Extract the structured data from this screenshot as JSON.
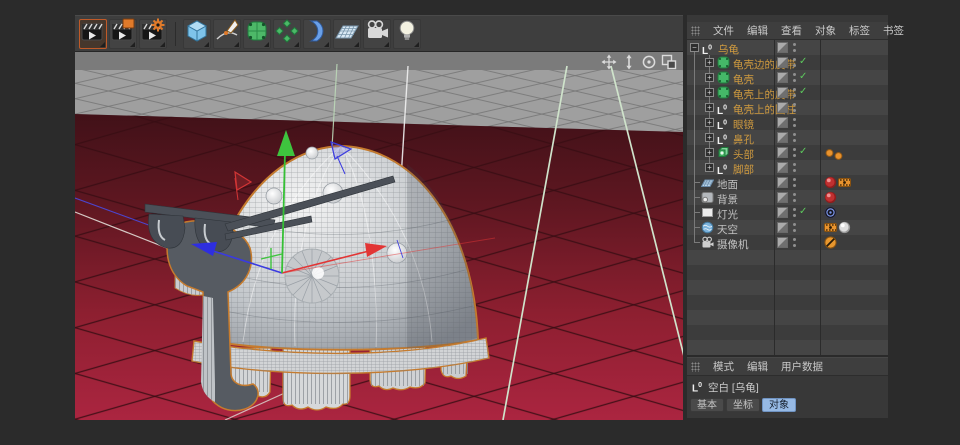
{
  "window": {
    "background": "#2b2b2b"
  },
  "toolbar": {
    "icons": [
      {
        "name": "render-view",
        "active": true
      },
      {
        "name": "render-to-picture-viewer",
        "active": false
      },
      {
        "name": "edit-render-settings",
        "active": false
      },
      {
        "name": "group-separator",
        "active": false
      },
      {
        "name": "add-cube",
        "active": false
      },
      {
        "name": "draw-spline",
        "active": false
      },
      {
        "name": "subdivision-surface",
        "active": false
      },
      {
        "name": "array-generator",
        "active": false
      },
      {
        "name": "bend-deformer",
        "active": false
      },
      {
        "name": "floor-environment",
        "active": false
      },
      {
        "name": "camera",
        "active": false
      },
      {
        "name": "light",
        "active": false
      }
    ]
  },
  "viewport": {
    "nav_icons": [
      "pan-icon",
      "zoom-icon",
      "rotate-icon",
      "toggle-view-icon"
    ],
    "colors": {
      "horizon_band": "#7b7b7b",
      "backdrop_plane": "#9f9f9f",
      "floor_near": "#ab2540",
      "floor_far": "#411118",
      "axis_x": "#e23535",
      "axis_y": "#3ec43e",
      "axis_z": "#3a3ae0",
      "selection_outline": "#c67b2d"
    }
  },
  "object_manager": {
    "menu": [
      "文件",
      "编辑",
      "查看",
      "对象",
      "标签",
      "书签"
    ],
    "tree": [
      {
        "label": "乌龟",
        "icon": "null",
        "depth": 0,
        "expand": "minus",
        "color": "orange",
        "check": false,
        "tags": []
      },
      {
        "label": "龟壳边的皮带",
        "icon": "subdiv",
        "depth": 1,
        "expand": "plus",
        "color": "orange",
        "check": true,
        "tags": []
      },
      {
        "label": "龟壳",
        "icon": "subdiv",
        "depth": 1,
        "expand": "plus",
        "color": "orange",
        "check": true,
        "tags": []
      },
      {
        "label": "龟壳上的皮带",
        "icon": "subdiv",
        "depth": 1,
        "expand": "plus",
        "color": "orange",
        "check": true,
        "tags": []
      },
      {
        "label": "龟壳上的圆柱",
        "icon": "null",
        "depth": 1,
        "expand": "plus",
        "color": "orange",
        "check": false,
        "tags": []
      },
      {
        "label": "眼镜",
        "icon": "null",
        "depth": 1,
        "expand": "plus",
        "color": "orange",
        "check": false,
        "tags": []
      },
      {
        "label": "鼻孔",
        "icon": "null",
        "depth": 1,
        "expand": "plus",
        "color": "orange",
        "check": false,
        "tags": []
      },
      {
        "label": "头部",
        "icon": "cube-green",
        "depth": 1,
        "expand": "plus",
        "color": "orange",
        "check": true,
        "tags": [
          "dot-orange",
          "dot-orange"
        ]
      },
      {
        "label": "脚部",
        "icon": "null",
        "depth": 1,
        "expand": "plus",
        "color": "orange",
        "check": false,
        "tags": []
      },
      {
        "label": "地面",
        "icon": "floor",
        "depth": 0,
        "expand": "",
        "color": "gray",
        "check": false,
        "tags": [
          "material-red",
          "compositing"
        ]
      },
      {
        "label": "背景",
        "icon": "background",
        "depth": 0,
        "expand": "",
        "color": "gray",
        "check": false,
        "tags": [
          "material-red"
        ]
      },
      {
        "label": "灯光",
        "icon": "light-area",
        "depth": 0,
        "expand": "",
        "color": "gray",
        "check": true,
        "tags": [
          "target"
        ]
      },
      {
        "label": "天空",
        "icon": "sky",
        "depth": 0,
        "expand": "",
        "color": "gray",
        "check": false,
        "tags": [
          "compositing",
          "material-gray"
        ]
      },
      {
        "label": "摄像机",
        "icon": "camera",
        "depth": 0,
        "expand": "",
        "color": "gray",
        "check": false,
        "tags": [
          "protection"
        ]
      }
    ]
  },
  "attribute_manager": {
    "menu": [
      "模式",
      "编辑",
      "用户数据"
    ],
    "object_icon": "null-icon",
    "object_label": "空白 [乌龟]",
    "tabs": [
      {
        "label": "基本",
        "selected": false
      },
      {
        "label": "坐标",
        "selected": false
      },
      {
        "label": "对象",
        "selected": true
      }
    ]
  }
}
